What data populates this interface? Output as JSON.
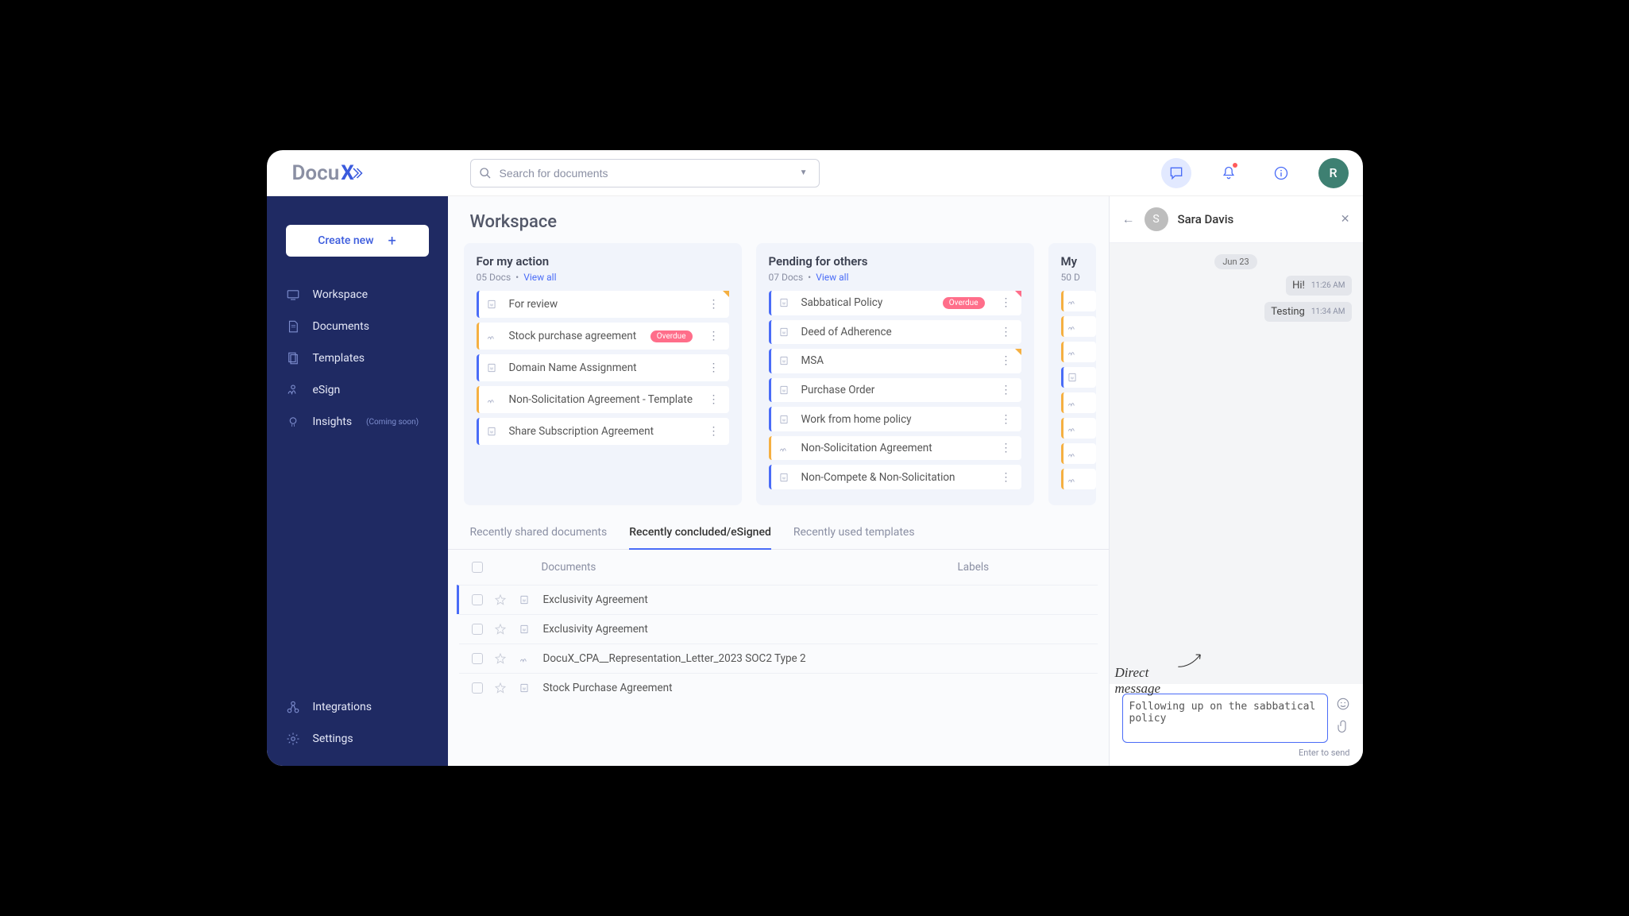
{
  "logo": {
    "part1": "Docu",
    "part2": "X"
  },
  "search": {
    "placeholder": "Search for documents"
  },
  "nav": {
    "create": "Create new",
    "items": [
      {
        "label": "Workspace"
      },
      {
        "label": "Documents"
      },
      {
        "label": "Templates"
      },
      {
        "label": "eSign"
      },
      {
        "label": "Insights",
        "tag": "(Coming soon)"
      }
    ],
    "bottom": [
      {
        "label": "Integrations"
      },
      {
        "label": "Settings"
      }
    ]
  },
  "page": {
    "title": "Workspace"
  },
  "avatar_letter": "R",
  "cards": [
    {
      "title": "For my action",
      "count": "05 Docs",
      "link": "View all",
      "items": [
        {
          "label": "For review",
          "border": "blue",
          "icon": "w",
          "flag": "o"
        },
        {
          "label": "Stock purchase agreement",
          "border": "orange",
          "icon": "sign",
          "badge": "Overdue"
        },
        {
          "label": "Domain Name Assignment",
          "border": "blue",
          "icon": "w"
        },
        {
          "label": "Non-Solicitation Agreement - Template",
          "border": "orange",
          "icon": "sign"
        },
        {
          "label": "Share Subscription Agreement",
          "border": "blue",
          "icon": "w"
        }
      ]
    },
    {
      "title": "Pending for others",
      "count": "07 Docs",
      "link": "View all",
      "items": [
        {
          "label": "Sabbatical Policy",
          "border": "blue",
          "icon": "w",
          "badge": "Overdue",
          "flag": "r"
        },
        {
          "label": "Deed of Adherence",
          "border": "blue",
          "icon": "w"
        },
        {
          "label": "MSA",
          "border": "blue",
          "icon": "w",
          "flag": "o"
        },
        {
          "label": "Purchase Order",
          "border": "blue",
          "icon": "w"
        },
        {
          "label": "Work from home policy",
          "border": "blue",
          "icon": "w"
        },
        {
          "label": "Non-Solicitation Agreement",
          "border": "orange",
          "icon": "sign"
        },
        {
          "label": "Non-Compete & Non-Solicitation",
          "border": "blue",
          "icon": "w"
        }
      ]
    },
    {
      "title": "My",
      "count": "50 D",
      "link": "",
      "items": [
        {
          "label": "",
          "border": "orange",
          "icon": "sign"
        },
        {
          "label": "",
          "border": "orange",
          "icon": "sign"
        },
        {
          "label": "",
          "border": "orange",
          "icon": "sign"
        },
        {
          "label": "",
          "border": "blue",
          "icon": "w"
        },
        {
          "label": "",
          "border": "orange",
          "icon": "sign"
        },
        {
          "label": "",
          "border": "orange",
          "icon": "sign"
        },
        {
          "label": "",
          "border": "orange",
          "icon": "sign"
        },
        {
          "label": "",
          "border": "orange",
          "icon": "sign"
        }
      ]
    }
  ],
  "tabs": [
    {
      "label": "Recently shared documents"
    },
    {
      "label": "Recently concluded/eSigned",
      "active": true
    },
    {
      "label": "Recently used templates"
    }
  ],
  "table": {
    "head_docs": "Documents",
    "head_labels": "Labels",
    "rows": [
      {
        "name": "Exclusivity Agreement",
        "icon": "w",
        "left": "blue"
      },
      {
        "name": "Exclusivity Agreement",
        "icon": "w"
      },
      {
        "name": "DocuX_CPA__Representation_Letter_2023 SOC2 Type 2",
        "icon": "sign"
      },
      {
        "name": "Stock Purchase Agreement",
        "icon": "w"
      }
    ]
  },
  "chat": {
    "name": "Sara Davis",
    "avatar": "S",
    "date": "Jun 23",
    "messages": [
      {
        "text": "Hi!",
        "ts": "11:26 AM"
      },
      {
        "text": "Testing",
        "ts": "11:34 AM"
      }
    ],
    "draft": "Following up on the sabbatical policy",
    "hint": "Enter to send"
  },
  "callout": "Direct message"
}
